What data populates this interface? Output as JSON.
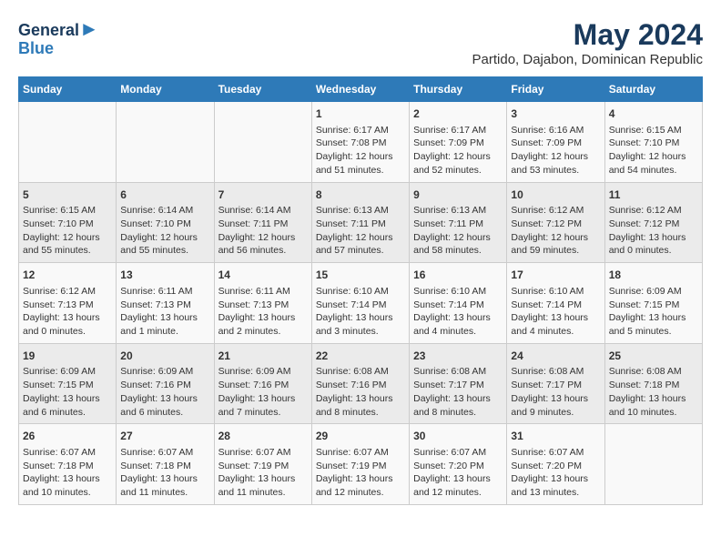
{
  "header": {
    "logo_line1": "General",
    "logo_line2": "Blue",
    "title": "May 2024",
    "subtitle": "Partido, Dajabon, Dominican Republic"
  },
  "days_of_week": [
    "Sunday",
    "Monday",
    "Tuesday",
    "Wednesday",
    "Thursday",
    "Friday",
    "Saturday"
  ],
  "weeks": [
    [
      {
        "day": "",
        "text": ""
      },
      {
        "day": "",
        "text": ""
      },
      {
        "day": "",
        "text": ""
      },
      {
        "day": "1",
        "text": "Sunrise: 6:17 AM\nSunset: 7:08 PM\nDaylight: 12 hours and 51 minutes."
      },
      {
        "day": "2",
        "text": "Sunrise: 6:17 AM\nSunset: 7:09 PM\nDaylight: 12 hours and 52 minutes."
      },
      {
        "day": "3",
        "text": "Sunrise: 6:16 AM\nSunset: 7:09 PM\nDaylight: 12 hours and 53 minutes."
      },
      {
        "day": "4",
        "text": "Sunrise: 6:15 AM\nSunset: 7:10 PM\nDaylight: 12 hours and 54 minutes."
      }
    ],
    [
      {
        "day": "5",
        "text": "Sunrise: 6:15 AM\nSunset: 7:10 PM\nDaylight: 12 hours and 55 minutes."
      },
      {
        "day": "6",
        "text": "Sunrise: 6:14 AM\nSunset: 7:10 PM\nDaylight: 12 hours and 55 minutes."
      },
      {
        "day": "7",
        "text": "Sunrise: 6:14 AM\nSunset: 7:11 PM\nDaylight: 12 hours and 56 minutes."
      },
      {
        "day": "8",
        "text": "Sunrise: 6:13 AM\nSunset: 7:11 PM\nDaylight: 12 hours and 57 minutes."
      },
      {
        "day": "9",
        "text": "Sunrise: 6:13 AM\nSunset: 7:11 PM\nDaylight: 12 hours and 58 minutes."
      },
      {
        "day": "10",
        "text": "Sunrise: 6:12 AM\nSunset: 7:12 PM\nDaylight: 12 hours and 59 minutes."
      },
      {
        "day": "11",
        "text": "Sunrise: 6:12 AM\nSunset: 7:12 PM\nDaylight: 13 hours and 0 minutes."
      }
    ],
    [
      {
        "day": "12",
        "text": "Sunrise: 6:12 AM\nSunset: 7:13 PM\nDaylight: 13 hours and 0 minutes."
      },
      {
        "day": "13",
        "text": "Sunrise: 6:11 AM\nSunset: 7:13 PM\nDaylight: 13 hours and 1 minute."
      },
      {
        "day": "14",
        "text": "Sunrise: 6:11 AM\nSunset: 7:13 PM\nDaylight: 13 hours and 2 minutes."
      },
      {
        "day": "15",
        "text": "Sunrise: 6:10 AM\nSunset: 7:14 PM\nDaylight: 13 hours and 3 minutes."
      },
      {
        "day": "16",
        "text": "Sunrise: 6:10 AM\nSunset: 7:14 PM\nDaylight: 13 hours and 4 minutes."
      },
      {
        "day": "17",
        "text": "Sunrise: 6:10 AM\nSunset: 7:14 PM\nDaylight: 13 hours and 4 minutes."
      },
      {
        "day": "18",
        "text": "Sunrise: 6:09 AM\nSunset: 7:15 PM\nDaylight: 13 hours and 5 minutes."
      }
    ],
    [
      {
        "day": "19",
        "text": "Sunrise: 6:09 AM\nSunset: 7:15 PM\nDaylight: 13 hours and 6 minutes."
      },
      {
        "day": "20",
        "text": "Sunrise: 6:09 AM\nSunset: 7:16 PM\nDaylight: 13 hours and 6 minutes."
      },
      {
        "day": "21",
        "text": "Sunrise: 6:09 AM\nSunset: 7:16 PM\nDaylight: 13 hours and 7 minutes."
      },
      {
        "day": "22",
        "text": "Sunrise: 6:08 AM\nSunset: 7:16 PM\nDaylight: 13 hours and 8 minutes."
      },
      {
        "day": "23",
        "text": "Sunrise: 6:08 AM\nSunset: 7:17 PM\nDaylight: 13 hours and 8 minutes."
      },
      {
        "day": "24",
        "text": "Sunrise: 6:08 AM\nSunset: 7:17 PM\nDaylight: 13 hours and 9 minutes."
      },
      {
        "day": "25",
        "text": "Sunrise: 6:08 AM\nSunset: 7:18 PM\nDaylight: 13 hours and 10 minutes."
      }
    ],
    [
      {
        "day": "26",
        "text": "Sunrise: 6:07 AM\nSunset: 7:18 PM\nDaylight: 13 hours and 10 minutes."
      },
      {
        "day": "27",
        "text": "Sunrise: 6:07 AM\nSunset: 7:18 PM\nDaylight: 13 hours and 11 minutes."
      },
      {
        "day": "28",
        "text": "Sunrise: 6:07 AM\nSunset: 7:19 PM\nDaylight: 13 hours and 11 minutes."
      },
      {
        "day": "29",
        "text": "Sunrise: 6:07 AM\nSunset: 7:19 PM\nDaylight: 13 hours and 12 minutes."
      },
      {
        "day": "30",
        "text": "Sunrise: 6:07 AM\nSunset: 7:20 PM\nDaylight: 13 hours and 12 minutes."
      },
      {
        "day": "31",
        "text": "Sunrise: 6:07 AM\nSunset: 7:20 PM\nDaylight: 13 hours and 13 minutes."
      },
      {
        "day": "",
        "text": ""
      }
    ]
  ]
}
